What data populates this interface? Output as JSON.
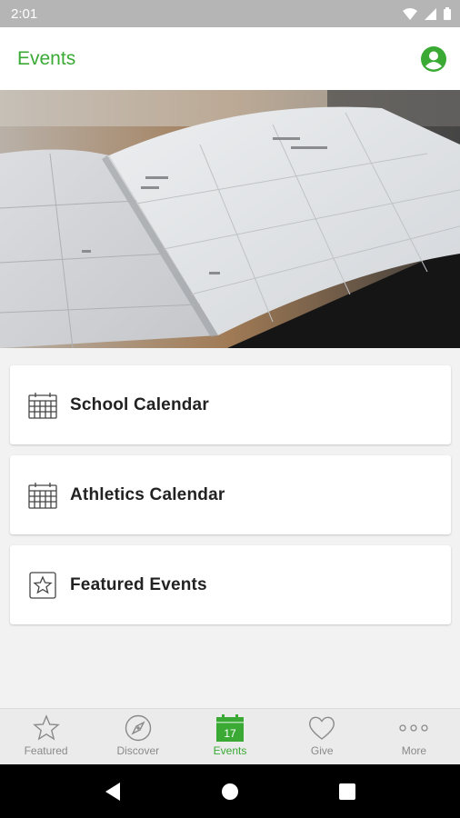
{
  "status_bar": {
    "time": "2:01"
  },
  "app_bar": {
    "title": "Events",
    "profile_icon": "account-circle-icon"
  },
  "hero": {
    "image": "open-planner-calendar-photo"
  },
  "list": [
    {
      "label": "School Calendar",
      "icon": "calendar-icon"
    },
    {
      "label": "Athletics Calendar",
      "icon": "calendar-icon"
    },
    {
      "label": "Featured Events",
      "icon": "star-box-icon"
    }
  ],
  "bottom_nav": [
    {
      "label": "Featured",
      "icon": "star-icon",
      "active": false
    },
    {
      "label": "Discover",
      "icon": "compass-icon",
      "active": false
    },
    {
      "label": "Events",
      "icon": "calendar-17-icon",
      "active": true,
      "badge_day": "17"
    },
    {
      "label": "Give",
      "icon": "heart-icon",
      "active": false
    },
    {
      "label": "More",
      "icon": "more-dots-icon",
      "active": false
    }
  ],
  "colors": {
    "accent": "#3aaa35",
    "background": "#f2f2f2",
    "status_bar": "#b5b5b5"
  }
}
